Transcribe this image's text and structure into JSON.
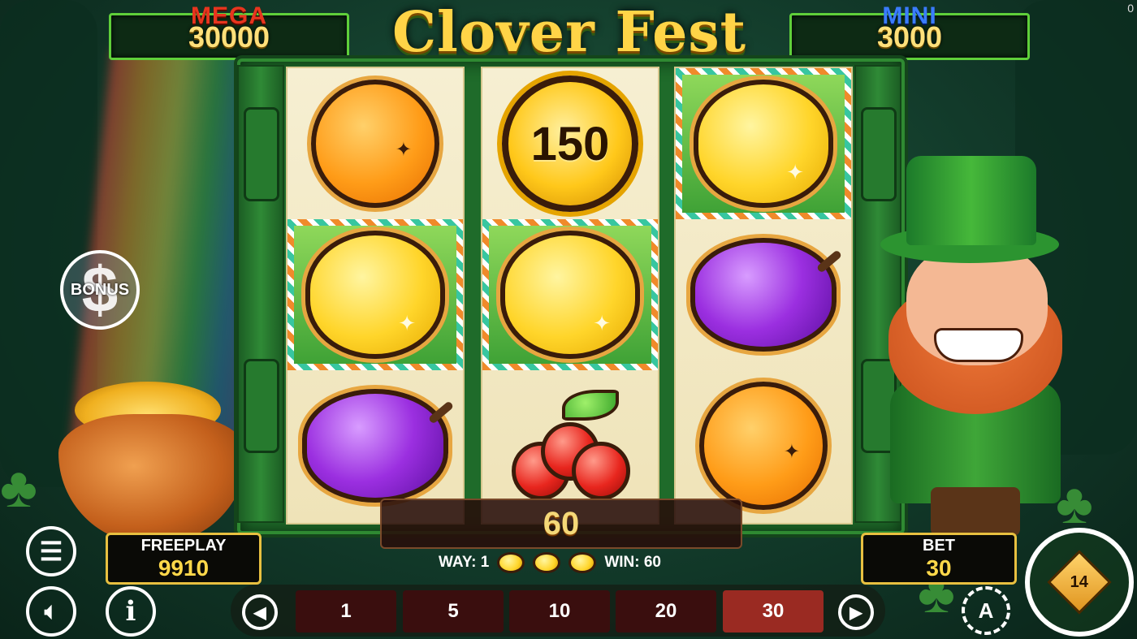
{
  "game": {
    "title": "Clover Fest",
    "corner_counter": "0"
  },
  "jackpots": {
    "mega": {
      "label": "MEGA",
      "value": "30000",
      "color": "#e8351e"
    },
    "mini": {
      "label": "MINI",
      "value": "3000",
      "color": "#3a7cff"
    }
  },
  "reels": [
    [
      {
        "symbol": "orange",
        "win": false
      },
      {
        "symbol": "lemon",
        "win": true
      },
      {
        "symbol": "plum",
        "win": false
      }
    ],
    [
      {
        "symbol": "coin",
        "value": "150",
        "win": false
      },
      {
        "symbol": "lemon",
        "win": true
      },
      {
        "symbol": "cherries",
        "win": false
      }
    ],
    [
      {
        "symbol": "lemon",
        "win": true
      },
      {
        "symbol": "plum",
        "win": false
      },
      {
        "symbol": "orange",
        "win": false
      }
    ]
  ],
  "win": {
    "amount": "60",
    "way_label": "WAY: 1",
    "win_label": "WIN: 60",
    "way_symbols": [
      "lemon",
      "lemon",
      "lemon"
    ]
  },
  "freeplay": {
    "label": "FREEPLAY",
    "value": "9910"
  },
  "bet": {
    "label": "BET",
    "value": "30"
  },
  "bet_options": [
    "1",
    "5",
    "10",
    "20",
    "30"
  ],
  "selected_bet": "30",
  "buttons": {
    "bonus": "BONUS",
    "menu_icon": "hamburger-menu-icon",
    "sound_icon": "speaker-icon",
    "info_icon": "info-icon",
    "prev_icon": "arrow-left-icon",
    "next_icon": "arrow-right-icon",
    "autoplay_label": "A",
    "spin_label": "14"
  },
  "colors": {
    "gold_text": "#ffd84a",
    "active_bet": "#9a2a22",
    "inactive_bet": "#3a0e0e",
    "frame_green": "#2f8a32"
  }
}
